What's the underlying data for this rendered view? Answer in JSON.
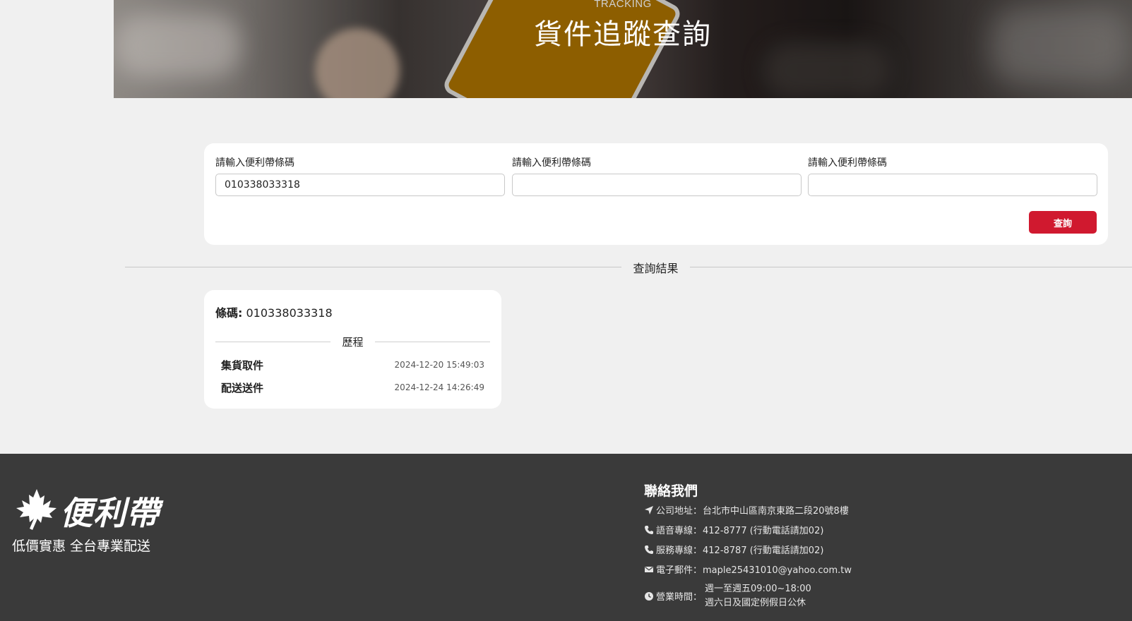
{
  "hero": {
    "subtitle": "TRACKING",
    "title": "貨件追蹤查詢"
  },
  "search": {
    "fields": [
      {
        "label": "請輸入便利帶條碼",
        "value": "010338033318",
        "placeholder": ""
      },
      {
        "label": "請輸入便利帶條碼",
        "value": "",
        "placeholder": ""
      },
      {
        "label": "請輸入便利帶條碼",
        "value": "",
        "placeholder": ""
      }
    ],
    "submit_label": "查詢"
  },
  "results": {
    "section_title": "查詢結果",
    "cards": [
      {
        "barcode_label": "條碼:",
        "barcode_value": "010338033318",
        "history_title": "歷程",
        "events": [
          {
            "name": "集貨取件",
            "time": "2024-12-20 15:49:03"
          },
          {
            "name": "配送送件",
            "time": "2024-12-24 14:26:49"
          }
        ]
      }
    ]
  },
  "footer": {
    "brand": "便利帶",
    "slogan": "低價實惠 全台專業配送",
    "contact": {
      "title": "聯絡我們",
      "address_label": "公司地址：",
      "address_value": "台北市中山區南京東路二段20號8樓",
      "voice_label": "語音專線：",
      "voice_value": "412-8777 (行動電話請加02)",
      "service_label": "服務專線：",
      "service_value": "412-8787 (行動電話請加02)",
      "email_label": "電子郵件：",
      "email_value": "maple25431010@yahoo.com.tw",
      "hours_label": "營業時間：",
      "hours_line1": "週一至週五09:00~18:00",
      "hours_line2": "週六日及國定例假日公休"
    },
    "icons": {
      "address": "location-arrow-icon",
      "voice": "phone-icon",
      "service": "phone-icon",
      "email": "envelope-icon",
      "hours": "clock-icon"
    }
  },
  "colors": {
    "accent": "#d0192f",
    "footer_bg": "#3a3a3a",
    "page_bg": "#f0f0f0",
    "phone_screen": "#9a6600"
  }
}
